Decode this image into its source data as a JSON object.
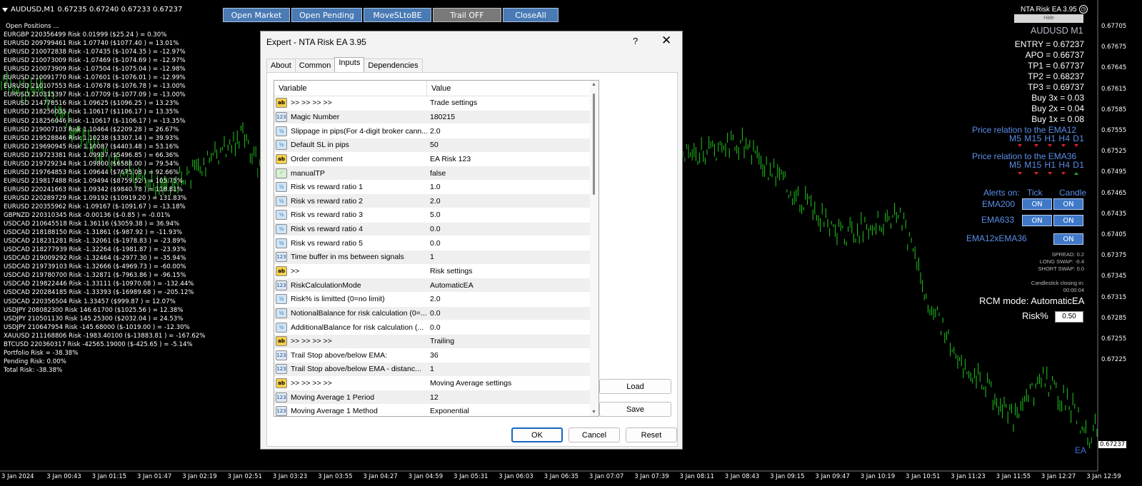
{
  "chart_header": {
    "symbol": "AUDUSD,M1",
    "prices": "0.67235 0.67240 0.67233 0.67237"
  },
  "toolbar": {
    "open_market": "Open Market",
    "open_pending": "Open Pending",
    "move_sl": "MoveSLtoBE",
    "trail": "Trail OFF",
    "close_all": "CloseAll"
  },
  "positions": {
    "header": "Open Positions ...",
    "lines": [
      "EURGBP 220356499 Risk 0.01999 ($25.24 ) = 0.30%",
      "EURUSD 209799461 Risk 1.07740 ($1077.40 ) = 13.01%",
      "EURUSD 210072838 Risk -1.07435 ($-1074.35 ) = -12.97%",
      "EURUSD 210073009 Risk -1.07469 ($-1074.69 ) = -12.97%",
      "EURUSD 210073909 Risk -1.07504 ($-1075.04 ) = -12.98%",
      "EURUSD 210091770 Risk -1.07601 ($-1076.01 ) = -12.99%",
      "EURUSD 210107553 Risk -1.07678 ($-1076.78 ) = -13.00%",
      "EURUSD 210315397 Risk -1.07709 ($-1077.09 ) = -13.00%",
      "EURUSD 214778516 Risk 1.09625 ($1096.25 ) = 13.23%",
      "EURUSD 218256035 Risk 1.10617 ($1106.17 ) = 13.35%",
      "EURUSD 218256046 Risk -1.10617 ($-1106.17 ) = -13.35%",
      "EURUSD 219007103 Risk 1.10464 ($2209.28 ) = 26.67%",
      "EURUSD 219528846 Risk 1.10238 ($3307.14 ) = 39.93%",
      "EURUSD 219690945 Risk 1.10087 ($4403.48 ) = 53.16%",
      "EURUSD 219723381 Risk 1.09937 ($5496.85 ) = 66.36%",
      "EURUSD 219729234 Risk 1.09800 ($6588.00 ) = 79.54%",
      "EURUSD 219764853 Risk 1.09644 ($7675.08 ) = 92.66%",
      "EURUSD 219817488 Risk 1.09494 ($8759.52 ) = 105.75%",
      "EURUSD 220241663 Risk 1.09342 ($9840.78 ) = 118.81%",
      "EURUSD 220289729 Risk 1.09192 ($10919.20 ) = 131.83%",
      "EURUSD 220355962 Risk -1.09167 ($-1091.67 ) = -13.18%",
      "GBPNZD 220310345 Risk -0.00136 ($-0.85 ) = -0.01%",
      "USDCAD 210645518 Risk 1.36116 ($3059.38 ) = 36.94%",
      "USDCAD 218188150 Risk -1.31861 ($-987.92 ) = -11.93%",
      "USDCAD 218231281 Risk -1.32061 ($-1978.83 ) = -23.89%",
      "USDCAD 218277939 Risk -1.32264 ($-1981.87 ) = -23.93%",
      "USDCAD 219009292 Risk -1.32464 ($-2977.30 ) = -35.94%",
      "USDCAD 219739103 Risk -1.32666 ($-4969.73 ) = -60.00%",
      "USDCAD 219780700 Risk -1.32871 ($-7963.86 ) = -96.15%",
      "USDCAD 219822446 Risk -1.33111 ($-10970.08 ) = -132.44%",
      "USDCAD 220284185 Risk -1.33393 ($-16989.68 ) = -205.12%",
      "USDCAD 220356504 Risk 1.33457 ($999.87 ) = 12.07%",
      "USDJPY 208082300 Risk 146.61700 ($1025.56 ) = 12.38%",
      "USDJPY 210501130 Risk 145.25300 ($2032.04 ) = 24.53%",
      "USDJPY 210647954 Risk -145.68000 ($-1019.00 ) = -12.30%",
      "XAUUSD 211168806 Risk -1983.40100 ($-13883.81 ) = -167.62%",
      "BTCUSD 220360317 Risk -42565.19000 ($-425.65 ) = -5.14%",
      "Portfolio Risk = -38.38%",
      "Pending Risk: 0.00%",
      "Total Risk: -38.38%"
    ]
  },
  "ea_panel": {
    "name": "NTA Risk EA 3.95",
    "hide": "Hide",
    "symbol": "AUDUSD M1",
    "levels": [
      "ENTRY = 0.67237",
      "APO = 0.66737",
      "TP1 = 0.67737",
      "TP2 = 0.68237",
      "TP3 = 0.69737",
      "Buy 3x = 0.03",
      "Buy 2x = 0.04",
      "Buy 1x = 0.08"
    ],
    "ema12_title": "Price relation to the EMA12",
    "ema36_title": "Price relation to the EMA36",
    "timeframes": "M5 M15 H1 H4 D1",
    "alerts_on": "Alerts on:",
    "tick": "Tick",
    "candle": "Candle",
    "ema200": "EMA200",
    "ema633": "EMA633",
    "ema12x36": "EMA12xEMA36",
    "on": "ON",
    "spread": "SPREAD: 0.2",
    "long_swap": "LONG SWAP: -0.4",
    "short_swap": "SHORT SWAP: 0.0",
    "candle_closing": "Candlestick closing in:",
    "candle_timer": "00:00:04",
    "rcm": "RCM mode: AutomaticEA",
    "risk_label": "Risk%",
    "risk_value": "0.50",
    "ea_tag": "EA"
  },
  "price_axis": {
    "labels": [
      "0.67705",
      "0.67675",
      "0.67645",
      "0.67615",
      "0.67585",
      "0.67555",
      "0.67525",
      "0.67495",
      "0.67465",
      "0.67435",
      "0.67405",
      "0.67375",
      "0.67345",
      "0.67315",
      "0.67285",
      "0.67255",
      "0.67225"
    ],
    "current": "0.67237"
  },
  "time_axis": [
    "3 Jan 2024",
    "3 Jan 00:43",
    "3 Jan 01:15",
    "3 Jan 01:47",
    "3 Jan 02:19",
    "3 Jan 02:51",
    "3 Jan 03:23",
    "3 Jan 03:55",
    "3 Jan 04:27",
    "3 Jan 04:59",
    "3 Jan 05:31",
    "3 Jan 06:03",
    "3 Jan 06:35",
    "3 Jan 07:07",
    "3 Jan 07:39",
    "3 Jan 08:11",
    "3 Jan 08:43",
    "3 Jan 09:15",
    "3 Jan 09:47",
    "3 Jan 10:19",
    "3 Jan 10:51",
    "3 Jan 11:23",
    "3 Jan 11:55",
    "3 Jan 12:27",
    "3 Jan 12:59"
  ],
  "dialog": {
    "title": "Expert - NTA Risk EA 3.95",
    "help": "?",
    "close": "✕",
    "tabs": [
      "About",
      "Common",
      "Inputs",
      "Dependencies"
    ],
    "col_variable": "Variable",
    "col_value": "Value",
    "rows": [
      {
        "icon": "ab",
        "var": ">> >> >> >>",
        "val": "Trade settings"
      },
      {
        "icon": "123",
        "var": "Magic Number",
        "val": "180215"
      },
      {
        "icon": "v2",
        "var": "Slippage in pips(For 4-digit broker cann...",
        "val": "2.0"
      },
      {
        "icon": "v2",
        "var": "Default SL in pips",
        "val": "50"
      },
      {
        "icon": "ab",
        "var": "Order comment",
        "val": "EA Risk 123"
      },
      {
        "icon": "tp",
        "var": "manualTP",
        "val": "false"
      },
      {
        "icon": "v2",
        "var": "Risk vs reward ratio 1",
        "val": "1.0"
      },
      {
        "icon": "v2",
        "var": "Risk vs reward ratio 2",
        "val": "2.0"
      },
      {
        "icon": "v2",
        "var": "Risk vs reward ratio 3",
        "val": "5.0"
      },
      {
        "icon": "v2",
        "var": "Risk vs reward ratio 4",
        "val": "0.0"
      },
      {
        "icon": "v2",
        "var": "Risk vs reward ratio 5",
        "val": "0.0"
      },
      {
        "icon": "123",
        "var": "Time buffer in ms between signals",
        "val": "1"
      },
      {
        "icon": "ab",
        "var": ">>",
        "val": "Risk settings"
      },
      {
        "icon": "123",
        "var": "RiskCalculationMode",
        "val": "AutomaticEA"
      },
      {
        "icon": "v2",
        "var": "Risk% is limitted (0=no limit)",
        "val": "2.0"
      },
      {
        "icon": "v2",
        "var": "NotionalBalance for risk calculation (0=...",
        "val": "0.0"
      },
      {
        "icon": "v2",
        "var": "AdditionalBalance for risk calculation (...",
        "val": "0.0"
      },
      {
        "icon": "ab",
        "var": ">> >> >> >>",
        "val": "Trailing"
      },
      {
        "icon": "123",
        "var": "Trail Stop above/below EMA:",
        "val": "36"
      },
      {
        "icon": "123",
        "var": "Trail Stop above/below EMA - distanc...",
        "val": "1"
      },
      {
        "icon": "ab",
        "var": ">> >> >> >>",
        "val": "Moving Average settings"
      },
      {
        "icon": "123",
        "var": "Moving Average 1 Period",
        "val": "12"
      },
      {
        "icon": "123",
        "var": "Moving Average 1 Method",
        "val": "Exponential"
      }
    ],
    "load": "Load",
    "save": "Save",
    "ok": "OK",
    "cancel": "Cancel",
    "reset": "Reset"
  },
  "colors": {
    "candle": "#22c81e",
    "panel_text": "#5a8fe8",
    "button": "#4a7bb5"
  }
}
